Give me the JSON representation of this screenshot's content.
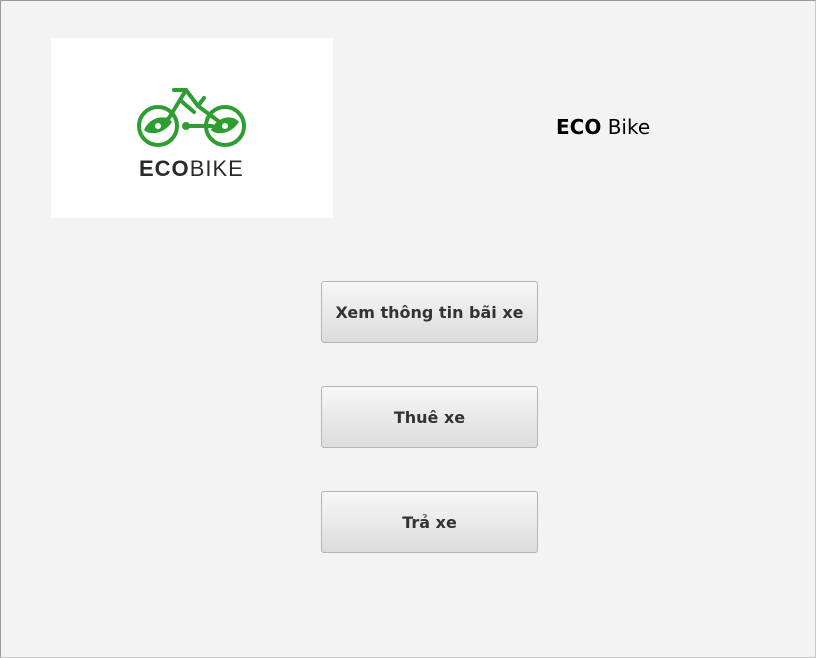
{
  "logo": {
    "name_part1": "ECO",
    "name_part2": "BIKE",
    "brand_color": "#2e9e33"
  },
  "title": {
    "brand": "ECO",
    "rest": " Bike"
  },
  "buttons": {
    "view_parking": "Xem thông tin bãi xe",
    "rent_bike": "Thuê xe",
    "return_bike": "Trả xe"
  }
}
